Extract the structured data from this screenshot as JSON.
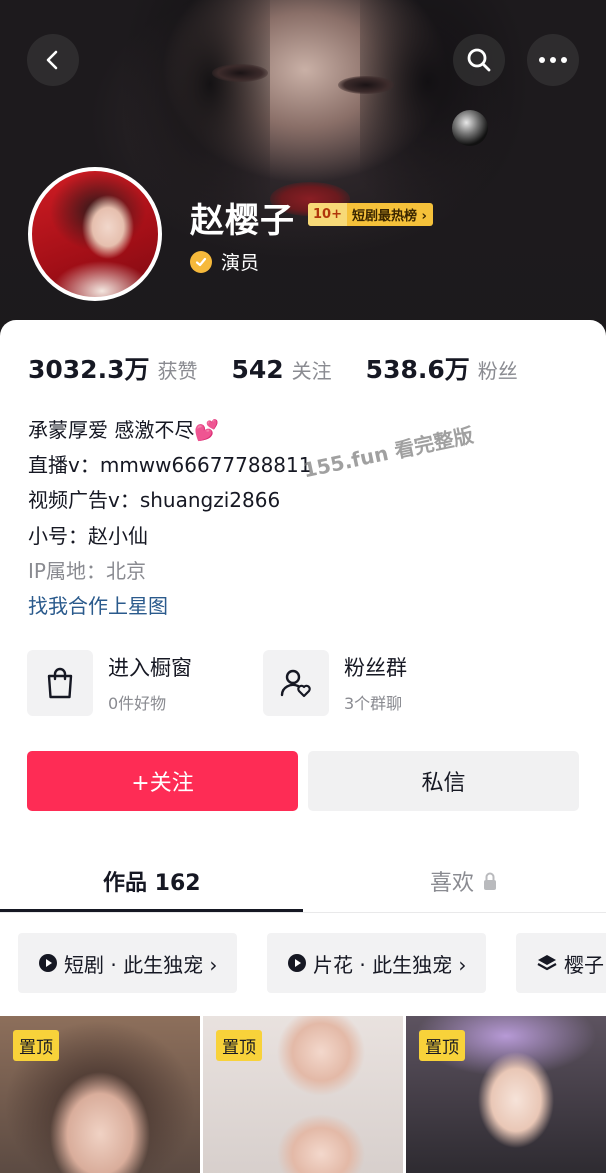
{
  "profile": {
    "name": "赵樱子",
    "rank_badge_num": "10+",
    "rank_badge_label": "短剧最热榜 ›",
    "verified_label": "演员"
  },
  "stats": [
    {
      "value": "3032.3万",
      "label": "获赞"
    },
    {
      "value": "542",
      "label": "关注"
    },
    {
      "value": "538.6万",
      "label": "粉丝"
    }
  ],
  "bio": {
    "line1": "承蒙厚爱 感激不尽💕",
    "line2": "直播v：mmww66677788811",
    "line3": "视频广告v：shuangzi2866",
    "line4": "小号：赵小仙",
    "ip": "IP属地：北京",
    "link": "找我合作上星图"
  },
  "watermark": "155.fun 看完整版",
  "features": [
    {
      "title": "进入橱窗",
      "sub": "0件好物",
      "icon": "shopping-bag-icon"
    },
    {
      "title": "粉丝群",
      "sub": "3个群聊",
      "icon": "fan-group-icon"
    }
  ],
  "buttons": {
    "follow": "+关注",
    "message": "私信"
  },
  "tabs": {
    "works": "作品 162",
    "likes": "喜欢"
  },
  "chips": [
    {
      "label": "短剧 · 此生独宠 ›",
      "icon": "play-icon"
    },
    {
      "label": "片花 · 此生独宠 ›",
      "icon": "play-icon"
    },
    {
      "label": "樱子",
      "icon": "layers-icon"
    }
  ],
  "thumbnails": [
    {
      "pin": "置顶"
    },
    {
      "pin": "置顶"
    },
    {
      "pin": "置顶"
    }
  ],
  "colors": {
    "accent": "#fe2c55",
    "badge": "#f5c13a",
    "verify": "#f6b93b",
    "link": "#2a5a8c"
  }
}
